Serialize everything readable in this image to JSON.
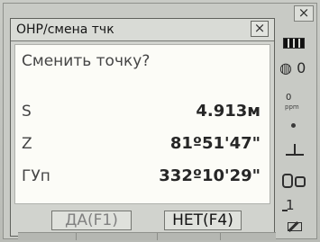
{
  "dialog": {
    "title": "ОНР/смена тчк",
    "close_glyph": "×",
    "prompt": "Сменить точку?",
    "rows": [
      {
        "label": "S",
        "value": "4.913м"
      },
      {
        "label": "Z",
        "value": "81º51'47\""
      },
      {
        "label": "ГУп",
        "value": "332º10'29\""
      }
    ],
    "buttons": {
      "yes": "ДА(F1)",
      "no": "НЕТ(F4)"
    }
  },
  "window": {
    "close_glyph": "×"
  },
  "status": {
    "prism_constant": "0",
    "ppm_value": "0",
    "ppm_label": "ppm",
    "page": "1"
  }
}
